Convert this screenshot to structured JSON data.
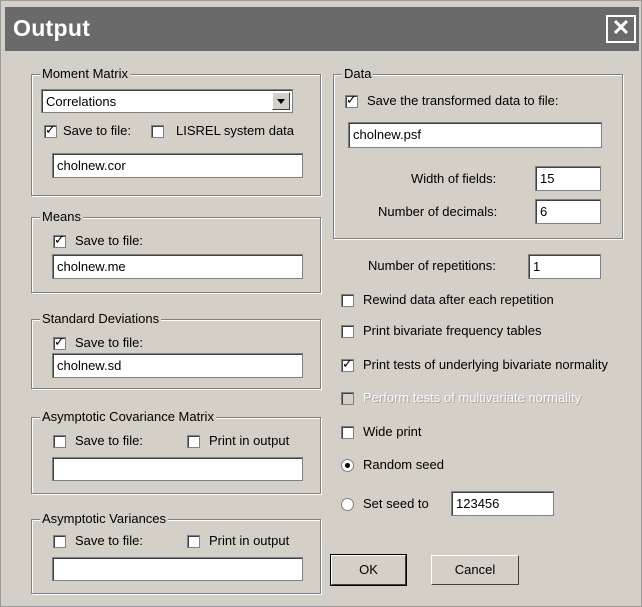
{
  "window": {
    "title": "Output",
    "close_glyph": "✕"
  },
  "moment_matrix": {
    "legend": "Moment Matrix",
    "select_value": "Correlations",
    "save_label": "Save to file:",
    "save_checked": true,
    "lisrel_label": "LISREL system data",
    "lisrel_checked": false,
    "file": "cholnew.cor"
  },
  "means": {
    "legend": "Means",
    "save_label": "Save to file:",
    "save_checked": true,
    "file": "cholnew.me"
  },
  "std_dev": {
    "legend": "Standard Deviations",
    "save_label": "Save to file:",
    "save_checked": true,
    "file": "cholnew.sd"
  },
  "acov": {
    "legend": "Asymptotic Covariance Matrix",
    "save_label": "Save to file:",
    "save_checked": false,
    "print_label": "Print in output",
    "print_checked": false,
    "file": ""
  },
  "avar": {
    "legend": "Asymptotic Variances",
    "save_label": "Save to file:",
    "save_checked": false,
    "print_label": "Print in output",
    "print_checked": false,
    "file": ""
  },
  "data": {
    "legend": "Data",
    "save_label": "Save the transformed data to file:",
    "save_checked": true,
    "file": "cholnew.psf",
    "width_label": "Width of fields:",
    "width_value": "15",
    "decimals_label": "Number of decimals:",
    "decimals_value": "6"
  },
  "repetitions": {
    "label": "Number of repetitions:",
    "value": "1"
  },
  "options": {
    "rewind_label": "Rewind data after each repetition",
    "rewind_checked": false,
    "bivariate_freq_label": "Print bivariate frequency tables",
    "bivariate_freq_checked": false,
    "bivariate_norm_label": "Print tests of underlying bivariate normality",
    "bivariate_norm_checked": true,
    "multivariate_label": "Perform tests of multivariate normality",
    "multivariate_checked": false,
    "wide_label": "Wide print",
    "wide_checked": false
  },
  "seed": {
    "random_label": "Random seed",
    "random_selected": true,
    "set_label": "Set seed to",
    "set_selected": false,
    "value": "123456"
  },
  "buttons": {
    "ok": "OK",
    "cancel": "Cancel"
  }
}
